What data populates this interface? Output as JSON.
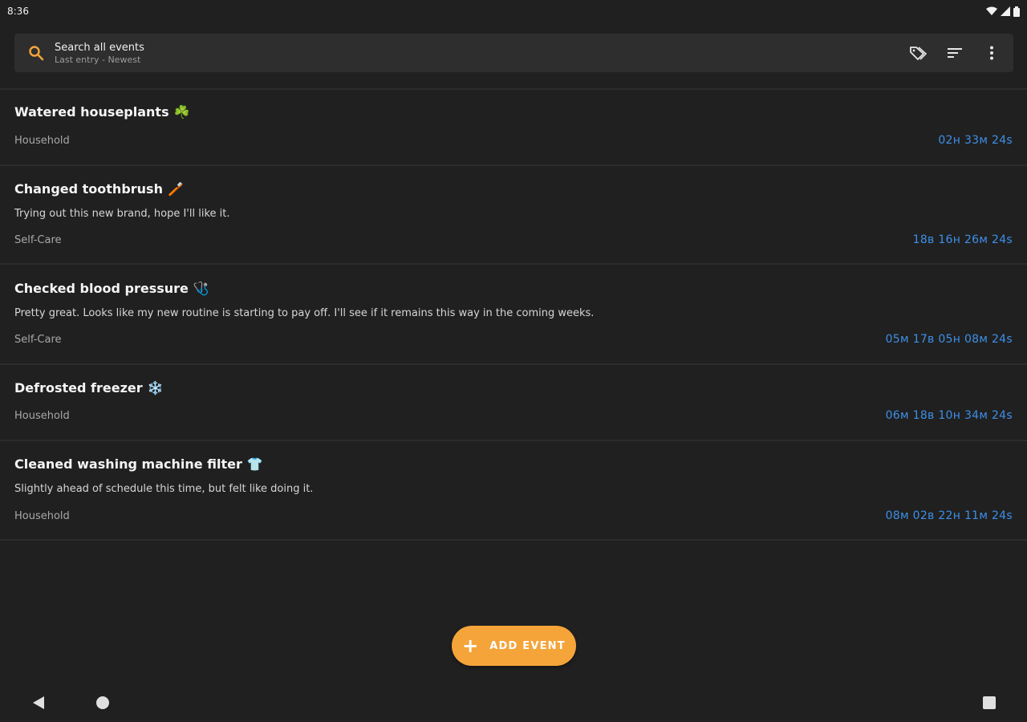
{
  "status_bar": {
    "time": "8:36",
    "icons": [
      "wifi-icon",
      "signal-icon",
      "battery-icon"
    ]
  },
  "search": {
    "title": "Search all events",
    "subtitle": "Last entry - Newest",
    "icons": [
      "search-icon",
      "tag-icon",
      "sort-icon",
      "more-vert-icon"
    ]
  },
  "events": [
    {
      "title": "Watered houseplants",
      "emoji": "☘️",
      "note": "",
      "category": "Household",
      "time": "02н 33м 24s"
    },
    {
      "title": "Changed toothbrush",
      "emoji": "🪥",
      "note": "Trying out this new brand, hope I'll like it.",
      "category": "Self-Care",
      "time": "18в 16н 26м 24s"
    },
    {
      "title": "Checked blood pressure",
      "emoji": "🩺",
      "note": "Pretty great. Looks like my new routine is starting to pay off. I'll see if it remains this way in the coming weeks.",
      "category": "Self-Care",
      "time": "05м 17в 05н 08м 24s"
    },
    {
      "title": "Defrosted freezer",
      "emoji": "❄️",
      "note": "",
      "category": "Household",
      "time": "06м 18в 10н 34м 24s"
    },
    {
      "title": "Cleaned washing machine filter",
      "emoji": "👕",
      "note": "Slightly ahead of schedule this time, but felt like doing it.",
      "category": "Household",
      "time": "08м 02в 22н 11м 24s"
    }
  ],
  "fab": {
    "icon": "plus-icon",
    "label": "ADD EVENT"
  },
  "colors": {
    "background": "#202020",
    "accent": "#f5a43a",
    "time_text": "#3d8fe8"
  },
  "nav": [
    "back-icon",
    "home-icon",
    "recents-icon"
  ]
}
